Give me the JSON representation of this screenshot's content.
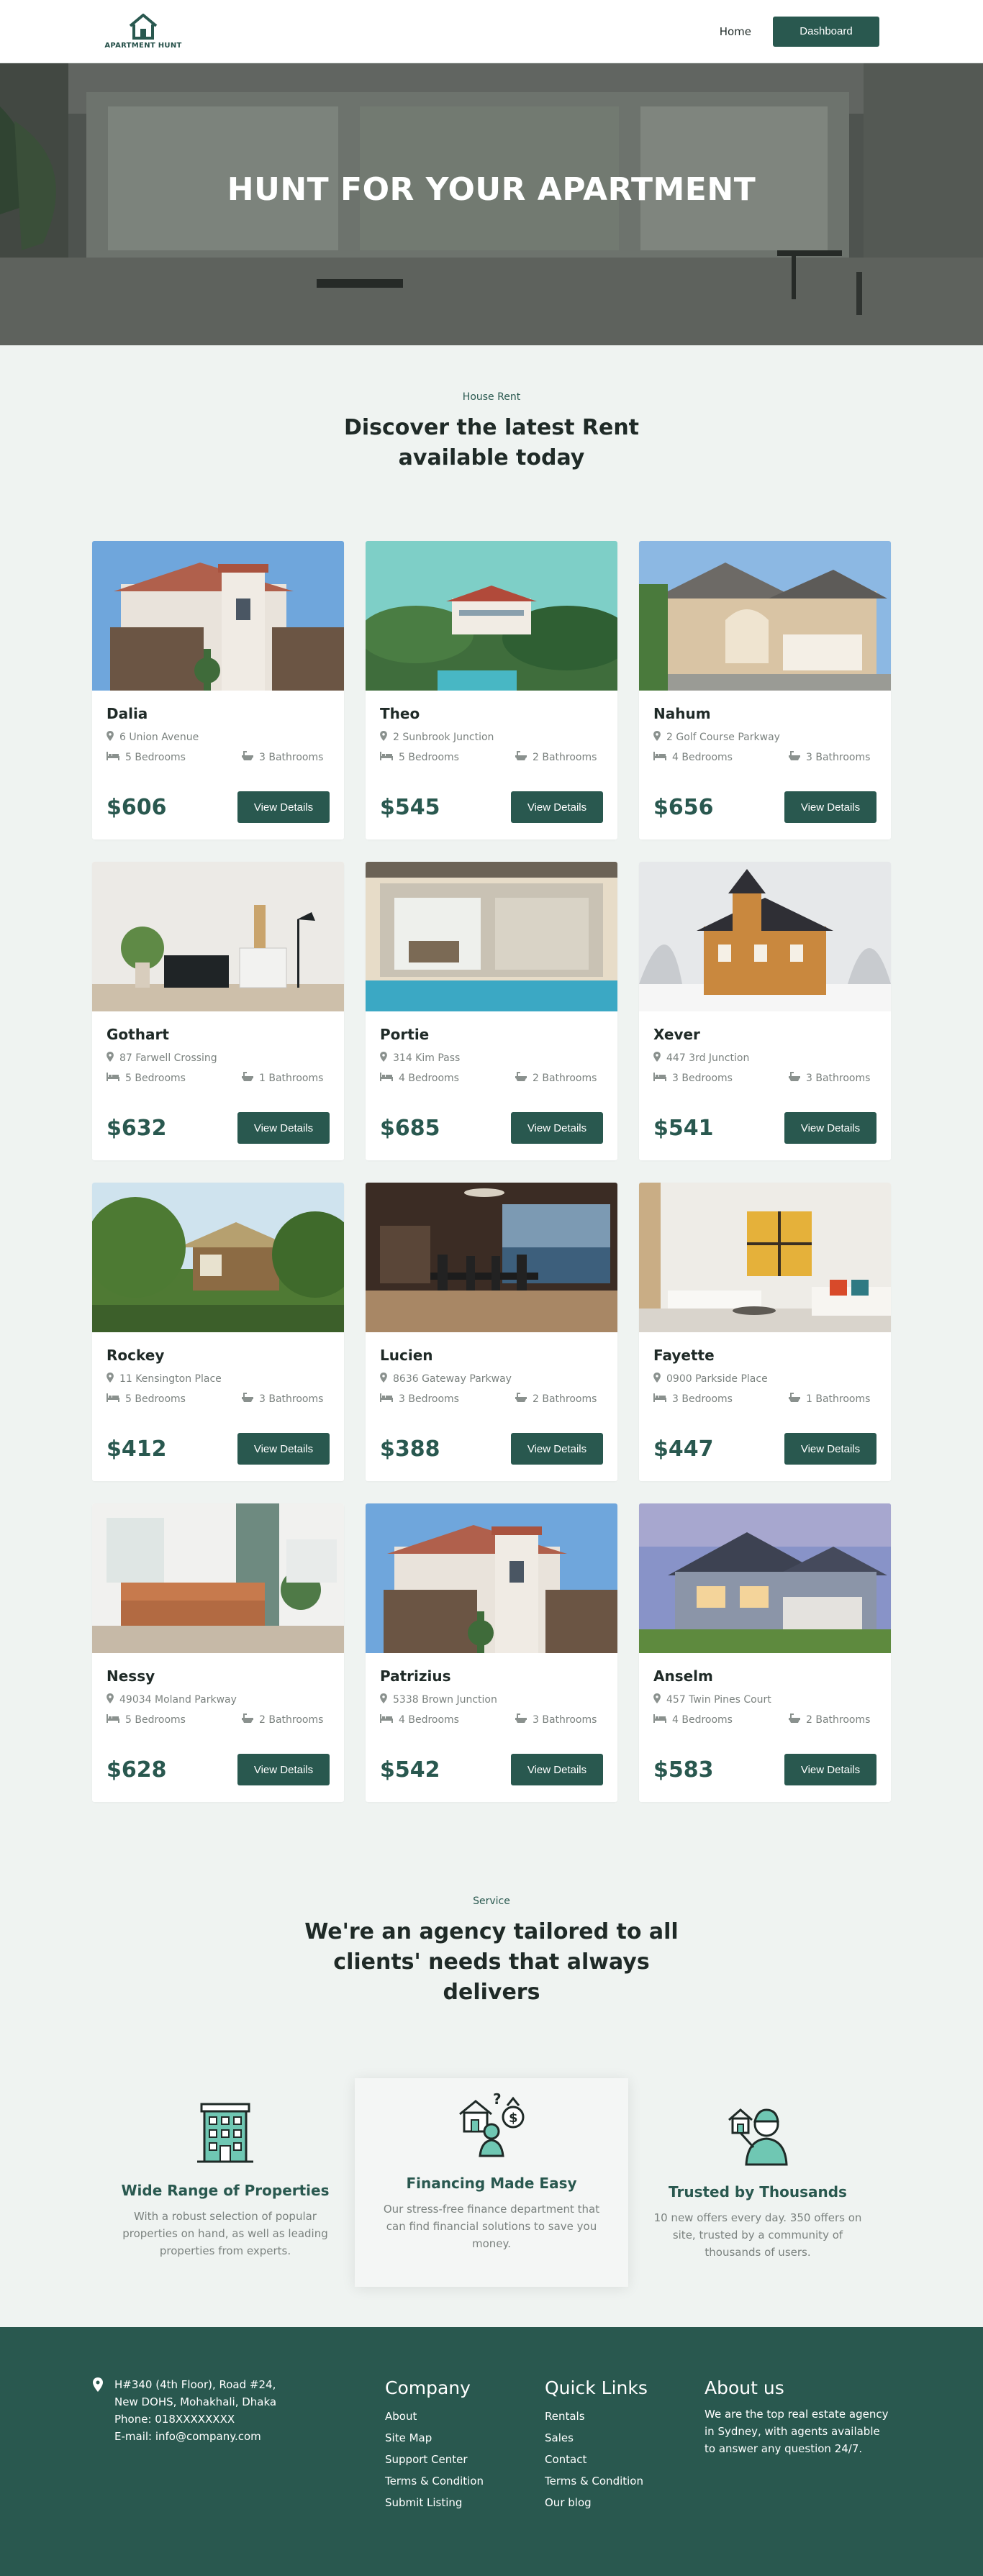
{
  "nav": {
    "logo_text": "APARTMENT HUNT",
    "home_label": "Home",
    "dashboard_label": "Dashboard"
  },
  "hero": {
    "title": "HUNT FOR YOUR APARTMENT"
  },
  "rent_section": {
    "eyebrow": "House Rent",
    "heading": "Discover the latest Rent available today"
  },
  "listings": [
    {
      "name": "Dalia",
      "address": "6 Union Avenue",
      "bedrooms": "5 Bedrooms",
      "bathrooms": "3 Bathrooms",
      "price": "$606",
      "button": "View Details",
      "photo": "white-villa"
    },
    {
      "name": "Theo",
      "address": "2 Sunbrook Junction",
      "bedrooms": "5 Bedrooms",
      "bathrooms": "2 Bathrooms",
      "price": "$545",
      "button": "View Details",
      "photo": "hilltop-resort"
    },
    {
      "name": "Nahum",
      "address": "2 Golf Course Parkway",
      "bedrooms": "4 Bedrooms",
      "bathrooms": "3 Bathrooms",
      "price": "$656",
      "button": "View Details",
      "photo": "beige-house"
    },
    {
      "name": "Gothart",
      "address": "87 Farwell Crossing",
      "bedrooms": "5 Bedrooms",
      "bathrooms": "1 Bathrooms",
      "price": "$632",
      "button": "View Details",
      "photo": "living-room"
    },
    {
      "name": "Portie",
      "address": "314 Kim Pass",
      "bedrooms": "4 Bedrooms",
      "bathrooms": "2 Bathrooms",
      "price": "$685",
      "button": "View Details",
      "photo": "pool-house"
    },
    {
      "name": "Xever",
      "address": "447 3rd Junction",
      "bedrooms": "3 Bedrooms",
      "bathrooms": "3 Bathrooms",
      "price": "$541",
      "button": "View Details",
      "photo": "winter-house"
    },
    {
      "name": "Rockey",
      "address": "11 Kensington Place",
      "bedrooms": "5 Bedrooms",
      "bathrooms": "3 Bathrooms",
      "price": "$412",
      "button": "View Details",
      "photo": "jungle-house"
    },
    {
      "name": "Lucien",
      "address": "8636 Gateway Parkway",
      "bedrooms": "3 Bedrooms",
      "bathrooms": "2 Bathrooms",
      "price": "$388",
      "button": "View Details",
      "photo": "dining-room"
    },
    {
      "name": "Fayette",
      "address": "0900 Parkside Place",
      "bedrooms": "3 Bedrooms",
      "bathrooms": "1 Bathrooms",
      "price": "$447",
      "button": "View Details",
      "photo": "bright-lounge"
    },
    {
      "name": "Nessy",
      "address": "49034 Moland Parkway",
      "bedrooms": "5 Bedrooms",
      "bathrooms": "2 Bathrooms",
      "price": "$628",
      "button": "View Details",
      "photo": "sofa-room"
    },
    {
      "name": "Patrizius",
      "address": "5338 Brown Junction",
      "bedrooms": "4 Bedrooms",
      "bathrooms": "3 Bathrooms",
      "price": "$542",
      "button": "View Details",
      "photo": "white-villa"
    },
    {
      "name": "Anselm",
      "address": "457 Twin Pines Court",
      "bedrooms": "4 Bedrooms",
      "bathrooms": "2 Bathrooms",
      "price": "$583",
      "button": "View Details",
      "photo": "dusk-house"
    }
  ],
  "service_section": {
    "eyebrow": "Service",
    "heading": "We're an agency tailored to all clients' needs that always delivers",
    "features": [
      {
        "title": "Wide Range of Properties",
        "text": "With a robust selection of popular properties on hand, as well as leading properties from experts.",
        "icon": "apartment-building-icon"
      },
      {
        "title": "Financing Made Easy",
        "text": "Our stress-free finance department that can find financial solutions to save you money.",
        "icon": "home-finance-icon"
      },
      {
        "title": "Trusted by Thousands",
        "text": "10 new offers every day. 350 offers on site, trusted by a community of thousands of users.",
        "icon": "agent-house-icon"
      }
    ]
  },
  "footer": {
    "contact_lines": [
      "H#340 (4th Floor), Road #24,",
      "New DOHS, Mohakhali, Dhaka",
      "Phone: 018XXXXXXXX",
      "E-mail: info@company.com"
    ],
    "company_heading": "Company",
    "company_links": [
      "About",
      "Site Map",
      "Support Center",
      "Terms & Condition",
      "Submit Listing"
    ],
    "quick_heading": "Quick Links",
    "quick_links": [
      "Rentals",
      "Sales",
      "Contact",
      "Terms & Condition",
      "Our blog"
    ],
    "about_heading": "About us",
    "about_text": "We are the top real estate agency in Sydney, with agents available to answer any question 24/7."
  },
  "colors": {
    "brand": "#29584f",
    "page_background": "#eff3f1",
    "muted_text": "#7b827f"
  }
}
